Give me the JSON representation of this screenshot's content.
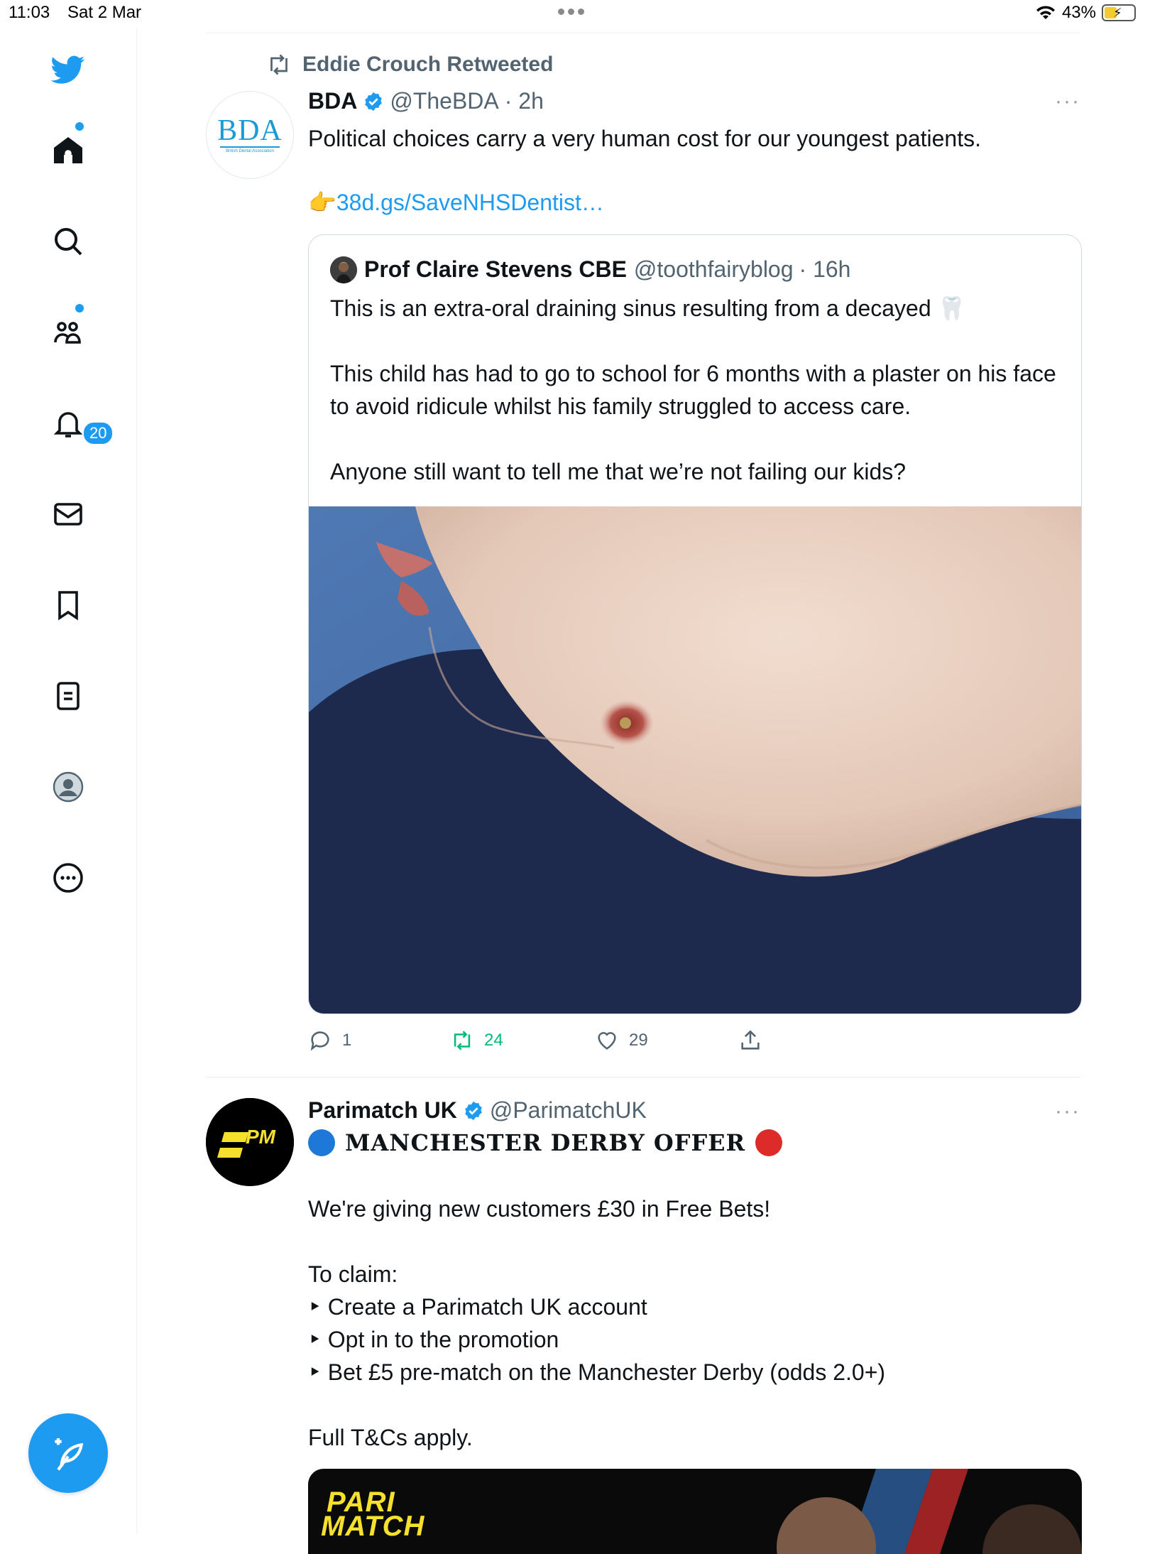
{
  "status_bar": {
    "time": "11:03",
    "date": "Sat 2 Mar",
    "battery": "43%",
    "battery_level": 0.43
  },
  "sidebar": {
    "items": [
      {
        "name": "home",
        "icon": "home-icon"
      },
      {
        "name": "explore",
        "icon": "search-icon"
      },
      {
        "name": "communities",
        "icon": "communities-icon"
      },
      {
        "name": "notifications",
        "icon": "bell-icon",
        "badge": "20"
      },
      {
        "name": "messages",
        "icon": "mail-icon"
      },
      {
        "name": "bookmarks",
        "icon": "bookmark-icon"
      },
      {
        "name": "lists",
        "icon": "list-icon"
      },
      {
        "name": "profile",
        "icon": "profile-icon"
      },
      {
        "name": "more",
        "icon": "more-circle-icon"
      }
    ],
    "compose_icon": "compose-feather-icon"
  },
  "tweet1": {
    "retweeted_by": "Eddie Crouch Retweeted",
    "author_name": "BDA",
    "author_handle": "@TheBDA",
    "time": "· 2h",
    "avatar_text": "BDA",
    "avatar_subtext": "British Dental Association",
    "text": "Political choices carry a very human cost for our youngest patients.",
    "link_emoji": "👉",
    "link": "38d.gs/SaveNHSDentist…",
    "more": "···",
    "quote": {
      "author_name": "Prof Claire Stevens CBE",
      "author_handle": "@toothfairyblog",
      "time": "· 16h",
      "text": "This is an extra-oral draining sinus resulting from a decayed 🦷\n\nThis child has had to go to school for 6 months with a plaster on his face to avoid ridicule whilst his family struggled to access care.\n\nAnyone still want to tell me that we’re not failing our kids?"
    },
    "stats": {
      "replies": "1",
      "retweets": "24",
      "likes": "29"
    },
    "colors": {
      "retweet_active": "#00ba7c",
      "link": "#1d9bf0"
    }
  },
  "tweet2": {
    "author_name": "Parimatch UK",
    "author_handle": "@ParimatchUK",
    "more": "···",
    "avatar_text": "PM",
    "headline": "MANCHESTER DERBY OFFER",
    "lines": [
      "We're giving new customers £30 in Free Bets!",
      "",
      "To claim:",
      "‣ Create a Parimatch UK account",
      "‣ Opt in to the promotion",
      "‣ Bet £5 pre-match on the Manchester Derby (odds 2.0+)",
      "",
      "Full T&Cs apply."
    ],
    "card_brand_line1": "PARI",
    "card_brand_line2": "MATCH",
    "brand_color": "#f5e02c"
  }
}
